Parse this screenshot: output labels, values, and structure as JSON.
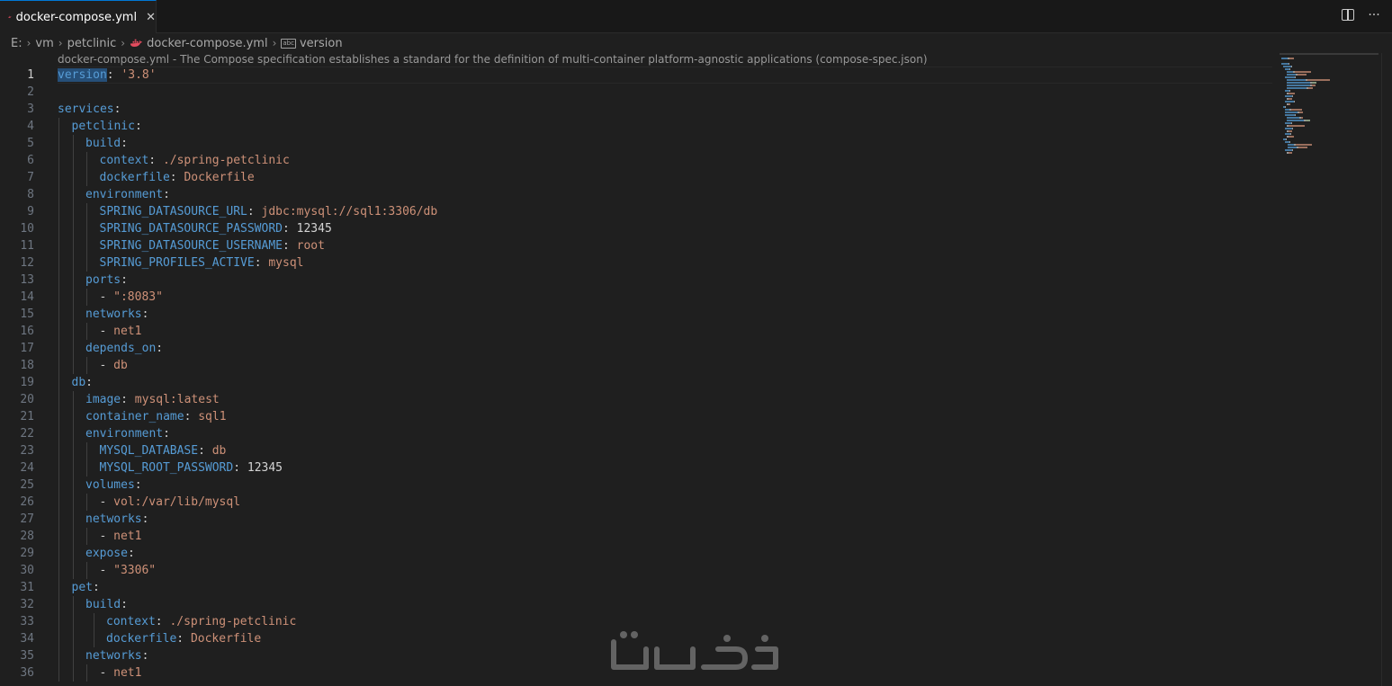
{
  "tab": {
    "label": "docker-compose.yml",
    "close": "✕"
  },
  "breadcrumb": {
    "items": [
      "E:",
      "vm",
      "petclinic",
      "docker-compose.yml",
      "version"
    ],
    "separator": "›"
  },
  "schema_hint": "docker-compose.yml - The Compose specification establishes a standard for the definition of multi-container platform-agnostic applications (compose-spec.json)",
  "current_line": 1,
  "lines": [
    {
      "n": "1",
      "indent": 0,
      "tokens": [
        [
          "k",
          "version"
        ],
        [
          "p",
          ": "
        ],
        [
          "s",
          "'3.8'"
        ]
      ]
    },
    {
      "n": "2",
      "indent": 0,
      "tokens": []
    },
    {
      "n": "3",
      "indent": 0,
      "tokens": [
        [
          "k",
          "services"
        ],
        [
          "p",
          ":"
        ]
      ]
    },
    {
      "n": "4",
      "indent": 1,
      "tokens": [
        [
          "k",
          "petclinic"
        ],
        [
          "p",
          ":"
        ]
      ]
    },
    {
      "n": "5",
      "indent": 2,
      "tokens": [
        [
          "k",
          "build"
        ],
        [
          "p",
          ":"
        ]
      ]
    },
    {
      "n": "6",
      "indent": 3,
      "tokens": [
        [
          "k",
          "context"
        ],
        [
          "p",
          ": "
        ],
        [
          "s",
          "./spring-petclinic"
        ]
      ]
    },
    {
      "n": "7",
      "indent": 3,
      "tokens": [
        [
          "k",
          "dockerfile"
        ],
        [
          "p",
          ": "
        ],
        [
          "s",
          "Dockerfile"
        ]
      ]
    },
    {
      "n": "8",
      "indent": 2,
      "tokens": [
        [
          "k",
          "environment"
        ],
        [
          "p",
          ":"
        ]
      ]
    },
    {
      "n": "9",
      "indent": 3,
      "tokens": [
        [
          "k",
          "SPRING_DATASOURCE_URL"
        ],
        [
          "p",
          ": "
        ],
        [
          "s",
          "jdbc:mysql://sql1:3306/db"
        ]
      ]
    },
    {
      "n": "10",
      "indent": 3,
      "tokens": [
        [
          "k",
          "SPRING_DATASOURCE_PASSWORD"
        ],
        [
          "p",
          ": "
        ],
        [
          "n",
          "12345"
        ]
      ]
    },
    {
      "n": "11",
      "indent": 3,
      "tokens": [
        [
          "k",
          "SPRING_DATASOURCE_USERNAME"
        ],
        [
          "p",
          ": "
        ],
        [
          "s",
          "root"
        ]
      ]
    },
    {
      "n": "12",
      "indent": 3,
      "tokens": [
        [
          "k",
          "SPRING_PROFILES_ACTIVE"
        ],
        [
          "p",
          ": "
        ],
        [
          "s",
          "mysql"
        ]
      ]
    },
    {
      "n": "13",
      "indent": 2,
      "tokens": [
        [
          "k",
          "ports"
        ],
        [
          "p",
          ":"
        ]
      ]
    },
    {
      "n": "14",
      "indent": 3,
      "tokens": [
        [
          "p",
          "- "
        ],
        [
          "s",
          "\":8083\""
        ]
      ]
    },
    {
      "n": "15",
      "indent": 2,
      "tokens": [
        [
          "k",
          "networks"
        ],
        [
          "p",
          ":"
        ]
      ]
    },
    {
      "n": "16",
      "indent": 3,
      "tokens": [
        [
          "p",
          "- "
        ],
        [
          "s",
          "net1"
        ]
      ]
    },
    {
      "n": "17",
      "indent": 2,
      "tokens": [
        [
          "k",
          "depends_on"
        ],
        [
          "p",
          ":"
        ]
      ]
    },
    {
      "n": "18",
      "indent": 3,
      "tokens": [
        [
          "p",
          "- "
        ],
        [
          "s",
          "db"
        ]
      ]
    },
    {
      "n": "19",
      "indent": 1,
      "tokens": [
        [
          "k",
          "db"
        ],
        [
          "p",
          ":"
        ]
      ]
    },
    {
      "n": "20",
      "indent": 2,
      "tokens": [
        [
          "k",
          "image"
        ],
        [
          "p",
          ": "
        ],
        [
          "s",
          "mysql:latest"
        ]
      ]
    },
    {
      "n": "21",
      "indent": 2,
      "tokens": [
        [
          "k",
          "container_name"
        ],
        [
          "p",
          ": "
        ],
        [
          "s",
          "sql1"
        ]
      ]
    },
    {
      "n": "22",
      "indent": 2,
      "tokens": [
        [
          "k",
          "environment"
        ],
        [
          "p",
          ":"
        ]
      ]
    },
    {
      "n": "23",
      "indent": 3,
      "tokens": [
        [
          "k",
          "MYSQL_DATABASE"
        ],
        [
          "p",
          ": "
        ],
        [
          "s",
          "db"
        ]
      ]
    },
    {
      "n": "24",
      "indent": 3,
      "tokens": [
        [
          "k",
          "MYSQL_ROOT_PASSWORD"
        ],
        [
          "p",
          ": "
        ],
        [
          "n",
          "12345"
        ]
      ]
    },
    {
      "n": "25",
      "indent": 2,
      "tokens": [
        [
          "k",
          "volumes"
        ],
        [
          "p",
          ":"
        ]
      ]
    },
    {
      "n": "26",
      "indent": 3,
      "tokens": [
        [
          "p",
          "- "
        ],
        [
          "s",
          "vol:/var/lib/mysql"
        ]
      ]
    },
    {
      "n": "27",
      "indent": 2,
      "tokens": [
        [
          "k",
          "networks"
        ],
        [
          "p",
          ":"
        ]
      ]
    },
    {
      "n": "28",
      "indent": 3,
      "tokens": [
        [
          "p",
          "- "
        ],
        [
          "s",
          "net1"
        ]
      ]
    },
    {
      "n": "29",
      "indent": 2,
      "tokens": [
        [
          "k",
          "expose"
        ],
        [
          "p",
          ":"
        ]
      ]
    },
    {
      "n": "30",
      "indent": 3,
      "tokens": [
        [
          "p",
          "- "
        ],
        [
          "s",
          "\"3306\""
        ]
      ]
    },
    {
      "n": "31",
      "indent": 1,
      "tokens": [
        [
          "k",
          "pet"
        ],
        [
          "p",
          ":"
        ]
      ]
    },
    {
      "n": "32",
      "indent": 2,
      "tokens": [
        [
          "k",
          "build"
        ],
        [
          "p",
          ":"
        ]
      ]
    },
    {
      "n": "33",
      "indent": 3.5,
      "tokens": [
        [
          "k",
          "context"
        ],
        [
          "p",
          ": "
        ],
        [
          "s",
          "./spring-petclinic"
        ]
      ]
    },
    {
      "n": "34",
      "indent": 3.5,
      "tokens": [
        [
          "k",
          "dockerfile"
        ],
        [
          "p",
          ": "
        ],
        [
          "s",
          "Dockerfile"
        ]
      ]
    },
    {
      "n": "35",
      "indent": 2,
      "tokens": [
        [
          "k",
          "networks"
        ],
        [
          "p",
          ":"
        ]
      ]
    },
    {
      "n": "36",
      "indent": 3,
      "tokens": [
        [
          "p",
          "- "
        ],
        [
          "s",
          "net1"
        ]
      ]
    }
  ],
  "colors": {
    "keyword": "#569cd6",
    "string": "#ce9178",
    "number": "#b5cea8",
    "punct": "#cccccc",
    "accent": "#0078d4",
    "docker_icon": "#e24c5e"
  },
  "icons": {
    "tab": "docker-whale-icon",
    "split": "split-editor-icon",
    "more": "more-actions-icon",
    "crumb_file": "docker-whale-icon",
    "crumb_symbol": "string-symbol-icon"
  },
  "symbol_icon_text": "abc",
  "more_label": "···"
}
